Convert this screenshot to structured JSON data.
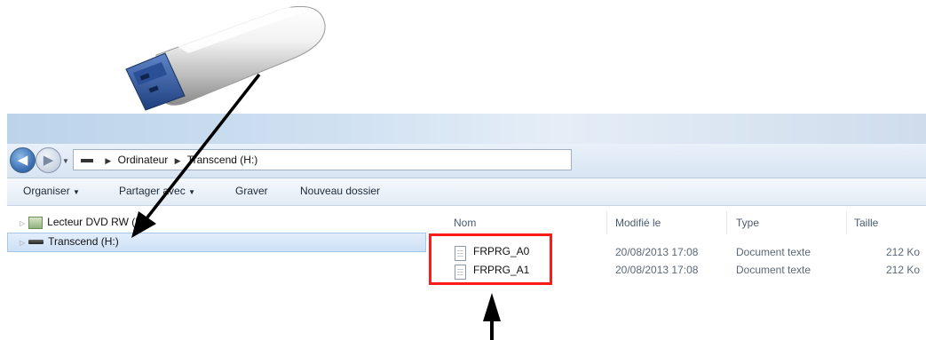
{
  "address_bar": {
    "path": [
      "Ordinateur",
      "Transcend (H:)"
    ]
  },
  "toolbar": {
    "organize": "Organiser",
    "share_with": "Partager avec",
    "burn": "Graver",
    "new_folder": "Nouveau dossier"
  },
  "nav_pane": {
    "items": [
      {
        "label": "Lecteur DVD RW (E:)",
        "icon": "dvd-drive-icon"
      },
      {
        "label": "Transcend (H:)",
        "icon": "usb-drive-icon",
        "selected": true
      }
    ]
  },
  "file_list": {
    "columns": [
      "Nom",
      "Modifié le",
      "Type",
      "Taille"
    ],
    "rows": [
      {
        "name": "FRPRG_A0",
        "modified": "20/08/2013 17:08",
        "type": "Document texte",
        "size": "212 Ko"
      },
      {
        "name": "FRPRG_A1",
        "modified": "20/08/2013 17:08",
        "type": "Document texte",
        "size": "212 Ko"
      }
    ]
  },
  "annotations": {
    "highlight_color": "#ff1a1a",
    "arrow_color": "#000000"
  }
}
